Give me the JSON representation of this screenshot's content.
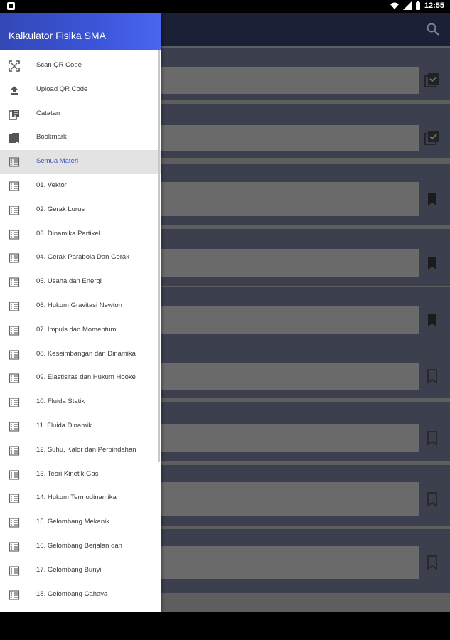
{
  "status": {
    "time": "12:55"
  },
  "drawer": {
    "title": "Kalkulator Fisika SMA",
    "items": [
      {
        "label": "Scan QR Code",
        "icon": "scan-qr-icon"
      },
      {
        "label": "Upload QR Code",
        "icon": "upload-icon"
      },
      {
        "label": "Catatan",
        "icon": "notes-icon"
      },
      {
        "label": "Bookmark",
        "icon": "bookmark-list-icon"
      },
      {
        "label": "Semua Materi",
        "icon": "list-icon",
        "active": true
      },
      {
        "label": "01. Vektor",
        "icon": "list-icon"
      },
      {
        "label": "02. Gerak Lurus",
        "icon": "list-icon"
      },
      {
        "label": "03. Dinamika Partikel",
        "icon": "list-icon"
      },
      {
        "label": "04. Gerak Parabola Dan Gerak",
        "icon": "list-icon"
      },
      {
        "label": "05. Usaha dan Energi",
        "icon": "list-icon"
      },
      {
        "label": "06. Hukum Gravitasi Newton",
        "icon": "list-icon"
      },
      {
        "label": "07. Impuls dan Momentum",
        "icon": "list-icon"
      },
      {
        "label": "08. Keseimbangan dan Dinamika",
        "icon": "list-icon"
      },
      {
        "label": "09. Elastisitas dan Hukum Hooke",
        "icon": "list-icon"
      },
      {
        "label": "10. Fluida Statik",
        "icon": "list-icon"
      },
      {
        "label": "11. Fluida Dinamik",
        "icon": "list-icon"
      },
      {
        "label": "12. Suhu, Kalor dan Perpindahan",
        "icon": "list-icon"
      },
      {
        "label": "13. Teori Kinetik Gas",
        "icon": "list-icon"
      },
      {
        "label": "14. Hukum Termodinamika",
        "icon": "list-icon"
      },
      {
        "label": "15. Gelombang Mekanik",
        "icon": "list-icon"
      },
      {
        "label": "16. Gelombang Berjalan dan",
        "icon": "list-icon"
      },
      {
        "label": "17. Gelombang Bunyi",
        "icon": "list-icon"
      },
      {
        "label": "18. Gelombang Cahaya",
        "icon": "list-icon"
      }
    ]
  },
  "appbar": {
    "search_icon": "search-icon"
  },
  "list_rows": [
    {
      "icon": "checklist-icon"
    },
    {
      "icon": "checklist-icon"
    },
    {
      "icon": "bookmark-filled-icon"
    },
    {
      "icon": "bookmark-filled-icon"
    },
    {
      "icon": "bookmark-filled-icon"
    },
    {
      "icon": "bookmark-outline-icon"
    },
    {
      "icon": "bookmark-outline-icon"
    },
    {
      "icon": "bookmark-outline-icon"
    },
    {
      "icon": "bookmark-outline-icon"
    }
  ],
  "colors": {
    "drawer_header": "#3b55d8",
    "active_label": "#4455c8",
    "appbar": "#1b2036"
  }
}
